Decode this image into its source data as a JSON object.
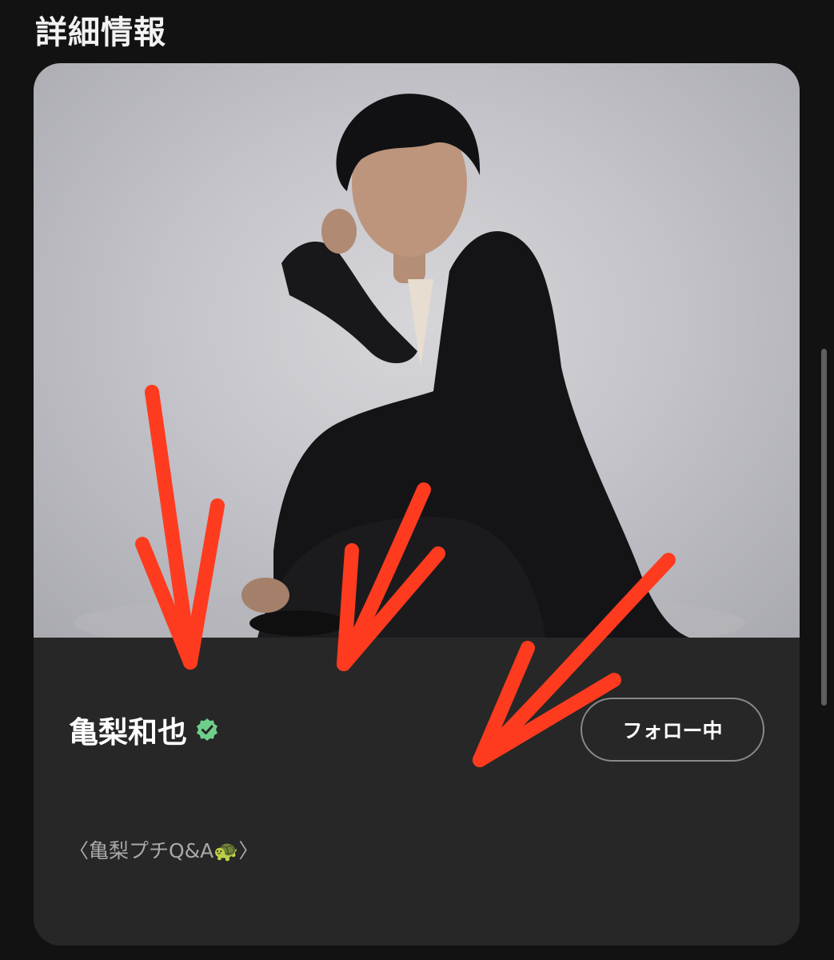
{
  "header": {
    "title": "詳細情報"
  },
  "artist": {
    "name": "亀梨和也",
    "verified_icon": "verified-badge-icon",
    "follow_label": "フォロー中",
    "description": "〈亀梨プチQ&A🐢〉"
  },
  "photo": {
    "alt": "artist-portrait",
    "background_color": "#c8c8cc"
  },
  "annotations": {
    "arrow_color": "#ff3b1f",
    "arrow_count": 3
  },
  "colors": {
    "page_background": "#121212",
    "card_background": "#272727",
    "verified": "#6fcf8a",
    "follow_border": "#8a8a8a"
  }
}
